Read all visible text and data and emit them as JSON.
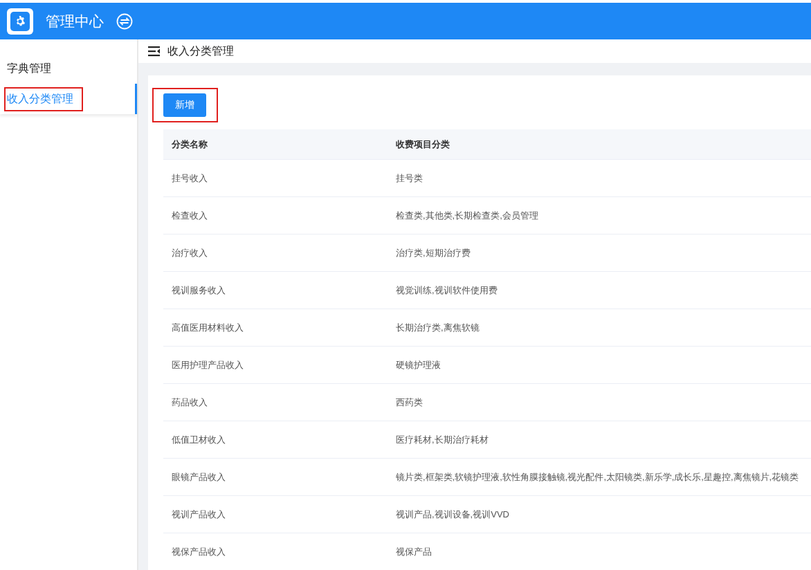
{
  "header": {
    "title": "管理中心"
  },
  "sidebar": {
    "items": [
      {
        "label": "字典管理",
        "selected": false,
        "highlighted": false
      },
      {
        "label": "收入分类管理",
        "selected": true,
        "highlighted": true
      }
    ]
  },
  "breadcrumb": {
    "title": "收入分类管理"
  },
  "add_button": {
    "label": "新增",
    "highlighted": true
  },
  "table": {
    "columns": [
      "分类名称",
      "收费项目分类"
    ],
    "rows": [
      [
        "挂号收入",
        "挂号类"
      ],
      [
        "检查收入",
        "检查类,其他类,长期检查类,会员管理"
      ],
      [
        "治疗收入",
        "治疗类,短期治疗费"
      ],
      [
        "视训服务收入",
        "视觉训练,视训软件使用费"
      ],
      [
        "高值医用材料收入",
        "长期治疗类,离焦软镜"
      ],
      [
        "医用护理产品收入",
        "硬镜护理液"
      ],
      [
        "药品收入",
        "西药类"
      ],
      [
        "低值卫材收入",
        "医疗耗材,长期治疗耗材"
      ],
      [
        "眼镜产品收入",
        "镜片类,框架类,软镜护理液,软性角膜接触镜,视光配件,太阳镜类,新乐学,成长乐,星趣控,离焦镜片,花镜类"
      ],
      [
        "视训产品收入",
        "视训产品,视训设备,视训VVD"
      ],
      [
        "视保产品收入",
        "视保产品"
      ]
    ]
  }
}
